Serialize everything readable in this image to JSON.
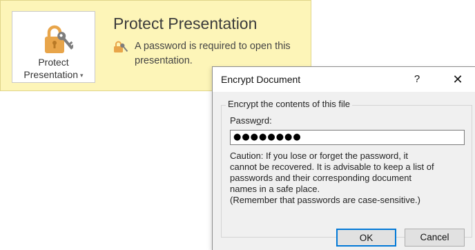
{
  "panel": {
    "button_label_line1": "Protect",
    "button_label_line2": "Presentation",
    "button_caret": "▾",
    "title": "Protect Presentation",
    "description": "A password is required to open this presentation."
  },
  "dialog": {
    "title": "Encrypt Document",
    "help_label": "?",
    "close_label": "✕",
    "group_label": "Encrypt the contents of this file",
    "password_label_pre": "Passw",
    "password_label_accel": "o",
    "password_label_post": "rd:",
    "password_value": "●●●●●●●●",
    "caution_lines": [
      "Caution: If you lose or forget the password, it",
      "cannot be recovered. It is advisable to keep a list of",
      "passwords and their corresponding document",
      "names in a safe place.",
      "(Remember that passwords are case-sensitive.)"
    ],
    "ok_label": "OK",
    "cancel_label": "Cancel"
  },
  "colors": {
    "panel_background": "#fdf5b8",
    "lock_gold": "#e8a54a",
    "key_gray": "#7d7d7d",
    "ok_border": "#0078d7",
    "dialog_background": "#f0f0f0"
  },
  "icons": {
    "protect_button": "lock-key-icon",
    "status": "small-lock-key-icon"
  }
}
